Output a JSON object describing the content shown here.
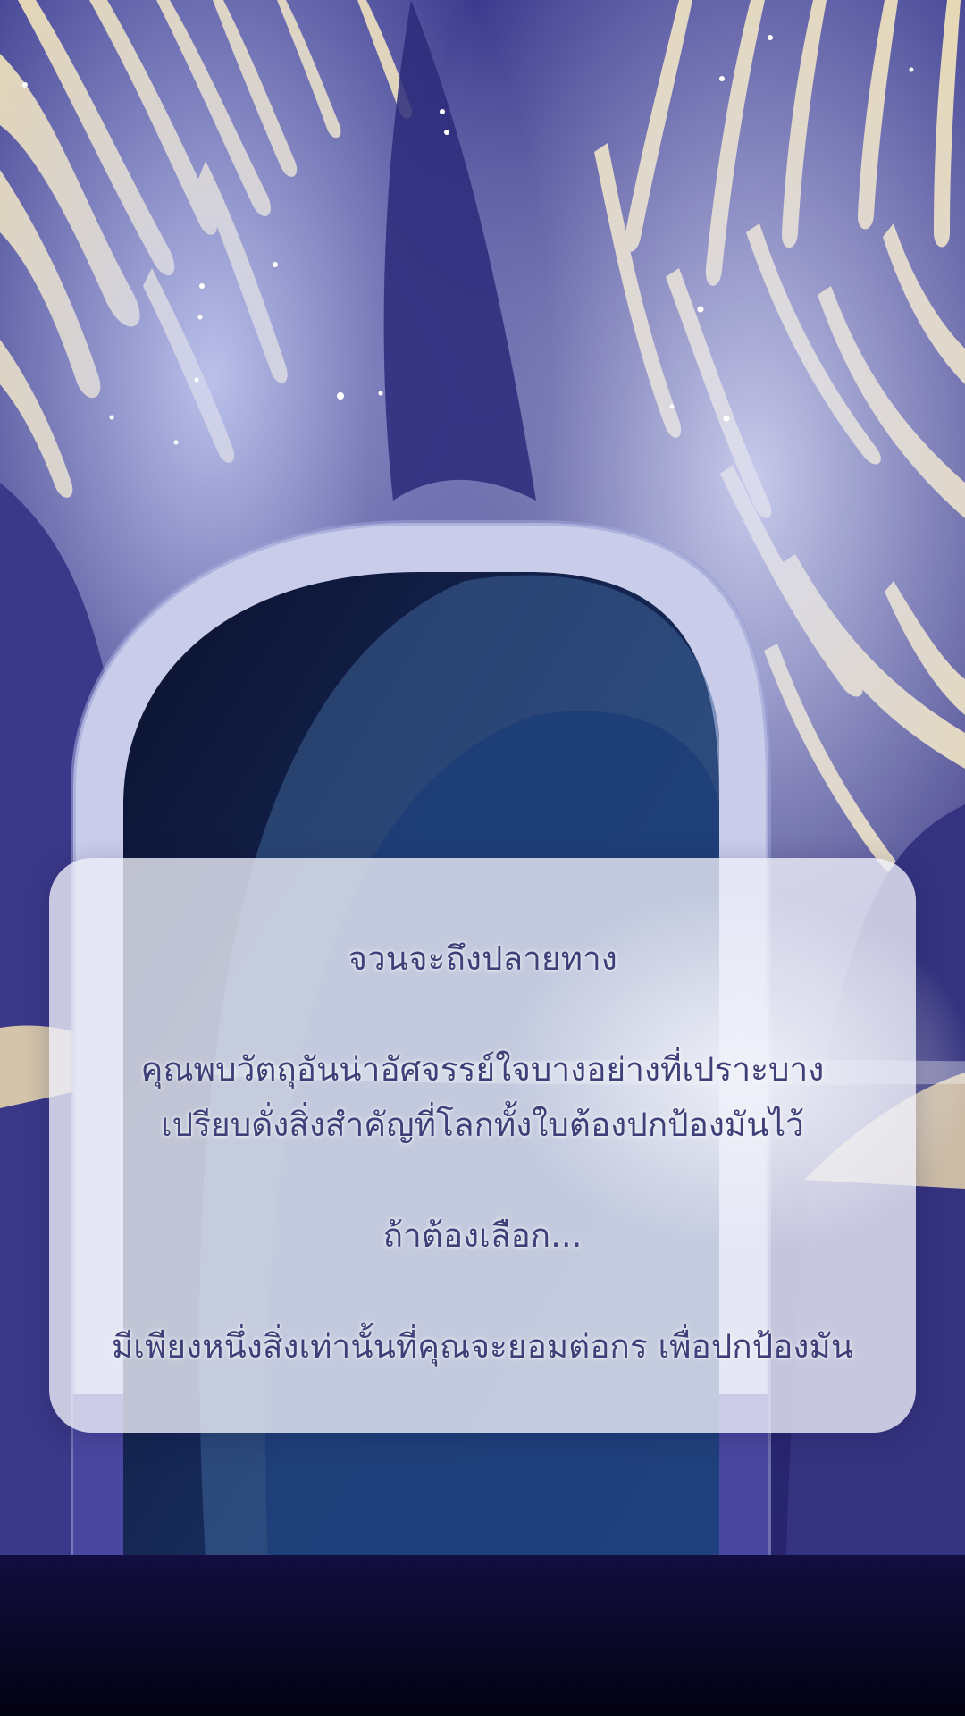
{
  "story": {
    "line1": "จวนจะถึงปลายทาง",
    "line2": "คุณพบวัตถุอันน่าอัศจรรย์ใจบางอย่างที่เปราะบาง",
    "line3": "เปรียบดั่งสิ่งสำคัญที่โลกทั้งใบต้องปกป้องมันไว้",
    "line4": "ถ้าต้องเลือก...",
    "line5": "มีเพียงหนึ่งสิ่งเท่านั้นที่คุณจะยอมต่อกร เพื่อปกป้องมัน"
  },
  "colors": {
    "text": "#3f4079",
    "background_deep": "#2e2a78",
    "stripe_cream": "#f3e2b0",
    "arch_light": "#cfd3ec",
    "floor": "#05031a"
  }
}
